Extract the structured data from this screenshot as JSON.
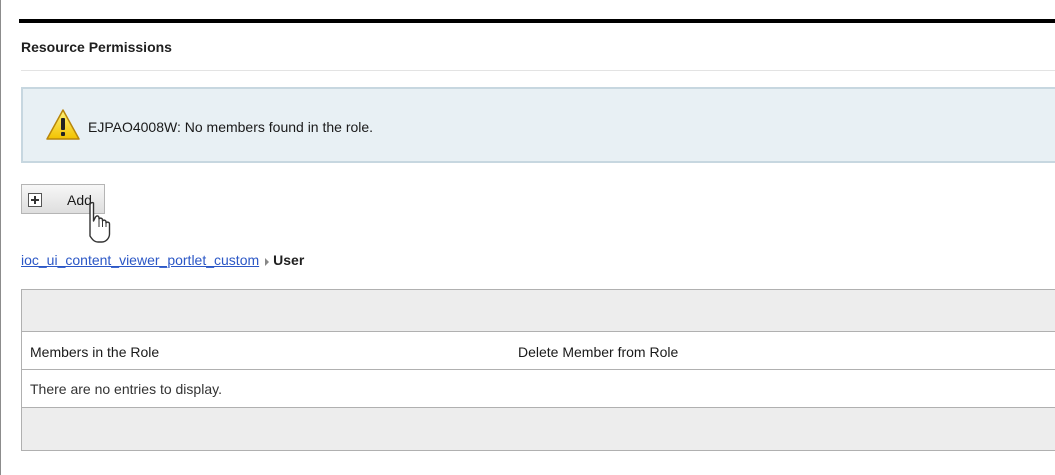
{
  "panel": {
    "title": "Resource Permissions"
  },
  "message": {
    "icon": "warning-icon",
    "text": "EJPAO4008W: No members found in the role.",
    "background": "#e8f0f4",
    "border": "#c7d7e0"
  },
  "toolbar": {
    "add_label": "Add",
    "add_icon": "plus-box-icon"
  },
  "breadcrumb": {
    "link": "ioc_ui_content_viewer_portlet_custom",
    "current": "User",
    "link_color": "#2b57c6"
  },
  "table": {
    "columns": [
      "Members in the Role",
      "Delete Member from Role"
    ],
    "empty_message": "There are no entries to display."
  },
  "cursor": {
    "icon": "mouse-pointer-icon"
  }
}
